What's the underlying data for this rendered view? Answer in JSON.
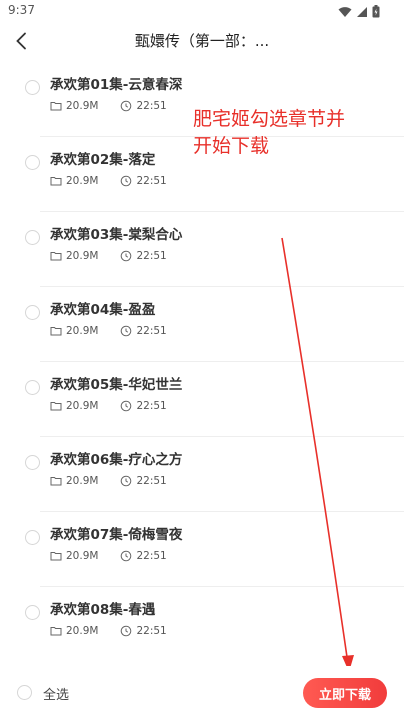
{
  "status_bar": {
    "time": "9:37"
  },
  "header": {
    "title": "甄嬛传（第一部：..."
  },
  "episodes": [
    {
      "title": "承欢第01集-云意春深",
      "size": "20.9M",
      "duration": "22:51"
    },
    {
      "title": "承欢第02集-落定",
      "size": "20.9M",
      "duration": "22:51"
    },
    {
      "title": "承欢第03集-棠梨合心",
      "size": "20.9M",
      "duration": "22:51"
    },
    {
      "title": "承欢第04集-盈盈",
      "size": "20.9M",
      "duration": "22:51"
    },
    {
      "title": "承欢第05集-华妃世兰",
      "size": "20.9M",
      "duration": "22:51"
    },
    {
      "title": "承欢第06集-疗心之方",
      "size": "20.9M",
      "duration": "22:51"
    },
    {
      "title": "承欢第07集-倚梅雪夜",
      "size": "20.9M",
      "duration": "22:51"
    },
    {
      "title": "承欢第08集-春遇",
      "size": "20.9M",
      "duration": "22:51"
    }
  ],
  "annotation": {
    "line1": "肥宅姬勾选章节并",
    "line2": "开始下载"
  },
  "footer": {
    "select_all_label": "全选",
    "download_label": "立即下载"
  },
  "colors": {
    "accent": "#f13c3c",
    "annotation": "#e8302a"
  }
}
